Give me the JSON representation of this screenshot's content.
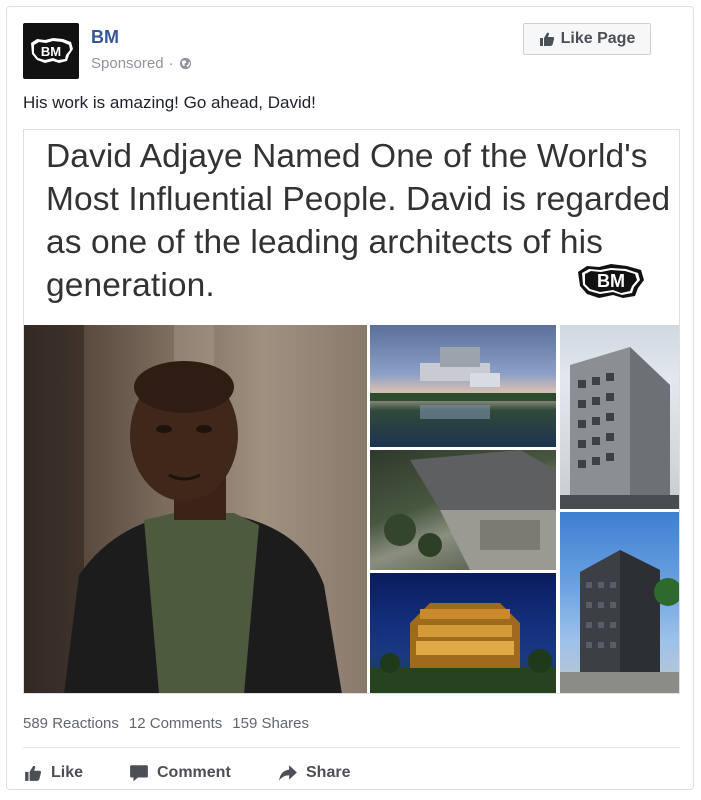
{
  "post": {
    "page_name": "BM",
    "avatar_text": "BM",
    "sponsored_label": "Sponsored",
    "sponsored_separator": "·",
    "like_page_label": "Like Page",
    "text": "His work is amazing! Go ahead, David!"
  },
  "media": {
    "headline": "David Adjaye Named One of the World's Most Influential People. David is regarded as one of the leading architects of his generation.",
    "logo_text": "BM"
  },
  "stats": {
    "reactions": "589 Reactions",
    "comments": "12 Comments",
    "shares": "159 Shares"
  },
  "actions": {
    "like": "Like",
    "comment": "Comment",
    "share": "Share"
  },
  "colors": {
    "link_blue": "#365899",
    "meta_gray": "#90949c",
    "action_gray": "#4b4f56"
  },
  "icons": {
    "avatar": "bm-logo-icon",
    "privacy": "globe-icon",
    "like_page": "thumbs-up-icon",
    "like": "thumbs-up-icon",
    "comment": "comment-bubble-icon",
    "share": "share-arrow-icon"
  }
}
